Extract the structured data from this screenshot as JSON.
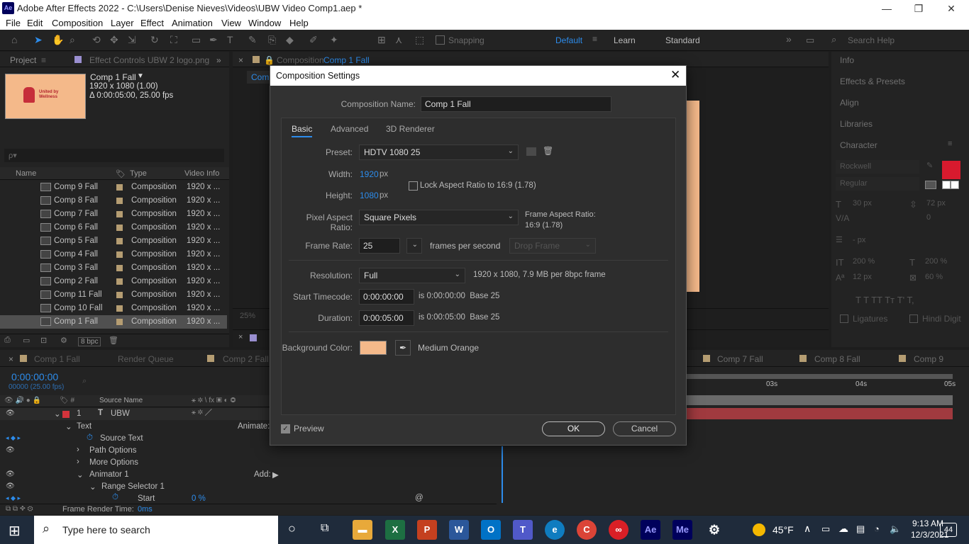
{
  "app": {
    "icon": "Ae",
    "title": "Adobe After Effects 2022 - C:\\Users\\Denise Nieves\\Videos\\UBW Video Comp1.aep *"
  },
  "menu": [
    "File",
    "Edit",
    "Composition",
    "Layer",
    "Effect",
    "Animation",
    "View",
    "Window",
    "Help"
  ],
  "toolbar": {
    "snapping": "Snapping",
    "workspaces": [
      "Default",
      "Learn",
      "Standard"
    ],
    "search_placeholder": "Search Help"
  },
  "project": {
    "tab": "Project",
    "effect_controls_tab": "Effect Controls UBW 2 logo.png",
    "thumb_text": "United by Wellness",
    "comp_name": "Comp 1 Fall",
    "comp_dims": "1920 x 1080 (1.00)",
    "comp_duration": "Δ 0:00:05:00, 25.00 fps",
    "search_placeholder": "ρ▾",
    "cols": {
      "name": "Name",
      "type": "Type",
      "video_info": "Video Info"
    },
    "items": [
      {
        "name": "Comp 9 Fall",
        "type": "Composition",
        "info": "1920 x ..."
      },
      {
        "name": "Comp 8 Fall",
        "type": "Composition",
        "info": "1920 x ..."
      },
      {
        "name": "Comp 7 Fall",
        "type": "Composition",
        "info": "1920 x ..."
      },
      {
        "name": "Comp 6 Fall",
        "type": "Composition",
        "info": "1920 x ..."
      },
      {
        "name": "Comp 5 Fall",
        "type": "Composition",
        "info": "1920 x ..."
      },
      {
        "name": "Comp 4 Fall",
        "type": "Composition",
        "info": "1920 x ..."
      },
      {
        "name": "Comp 3 Fall",
        "type": "Composition",
        "info": "1920 x ..."
      },
      {
        "name": "Comp 2 Fall",
        "type": "Composition",
        "info": "1920 x ..."
      },
      {
        "name": "Comp 11 Fall",
        "type": "Composition",
        "info": "1920 x ..."
      },
      {
        "name": "Comp 10 Fall",
        "type": "Composition",
        "info": "1920 x ..."
      },
      {
        "name": "Comp 1 Fall",
        "type": "Composition",
        "info": "1920 x ..."
      }
    ],
    "bpc": "8 bpc"
  },
  "viewer": {
    "tab_prefix": "Composition",
    "tab_name": "Comp 1 Fall",
    "zoom": "25%",
    "sub_tab": "Com"
  },
  "dialog": {
    "title": "Composition Settings",
    "name_label": "Composition Name:",
    "name_value": "Comp 1 Fall",
    "tabs": [
      "Basic",
      "Advanced",
      "3D Renderer"
    ],
    "preset_label": "Preset:",
    "preset_value": "HDTV 1080 25",
    "width_label": "Width:",
    "width_value": "1920",
    "width_unit": "px",
    "height_label": "Height:",
    "height_value": "1080",
    "height_unit": "px",
    "lock_label": "Lock Aspect Ratio to 16:9 (1.78)",
    "par_label": "Pixel Aspect Ratio:",
    "par_value": "Square Pixels",
    "far_label": "Frame Aspect Ratio:",
    "far_value": "16:9 (1.78)",
    "fr_label": "Frame Rate:",
    "fr_value": "25",
    "fr_unit": "frames per second",
    "drop_frame": "Drop Frame",
    "res_label": "Resolution:",
    "res_value": "Full",
    "res_info": "1920 x 1080, 7.9 MB per 8bpc frame",
    "st_label": "Start Timecode:",
    "st_value": "0:00:00:00",
    "st_info": "is 0:00:00:00  Base 25",
    "dur_label": "Duration:",
    "dur_value": "0:00:05:00",
    "dur_info": "is 0:00:05:00  Base 25",
    "bg_label": "Background Color:",
    "bg_color": "#f4b98a",
    "bg_name": "Medium Orange",
    "preview_label": "Preview",
    "ok": "OK",
    "cancel": "Cancel"
  },
  "right_panel": {
    "items": [
      "Info",
      "Effects & Presets",
      "Align",
      "Libraries",
      "Character"
    ],
    "font": "Rockwell",
    "style": "Regular",
    "size": "30 px",
    "leading": "72 px",
    "kerning": "0",
    "stroke": "- px",
    "vscale": "200 %",
    "hscale": "200 %",
    "baseline": "12 px",
    "tsume": "60 %",
    "ligatures": "Ligatures",
    "hindi": "Hindi Digit",
    "fill_color": "#d81a2e"
  },
  "timeline": {
    "tab": "Comp 1 Fall",
    "render_queue": "Render Queue",
    "tab2": "Comp 2 Fall",
    "tab7": "Comp 7 Fall",
    "tab8": "Comp 8 Fall",
    "tab9": "Comp 9",
    "timecode": "0:00:00:00",
    "frames": "00000 (25.00 fps)",
    "source_name": "Source Name",
    "layer_num": "1",
    "layer_name": "UBW",
    "animate": "Animate:",
    "add": "Add:",
    "props": [
      "Text",
      "Source Text",
      "Path Options",
      "More Options",
      "Animator 1",
      "Range Selector 1",
      "Start"
    ],
    "start_value": "0 %",
    "render_time_label": "Frame Render Time:",
    "render_time": "0ms",
    "ruler": [
      "03s",
      "04s",
      "05s"
    ]
  },
  "taskbar": {
    "search_placeholder": "Type here to search",
    "weather": "45°F",
    "time": "9:13 AM",
    "date": "12/3/2021",
    "notif": "44",
    "apps": [
      "X",
      "P",
      "W",
      "O",
      "T",
      "e",
      "C",
      "Ae",
      "Me",
      "⚙"
    ]
  }
}
